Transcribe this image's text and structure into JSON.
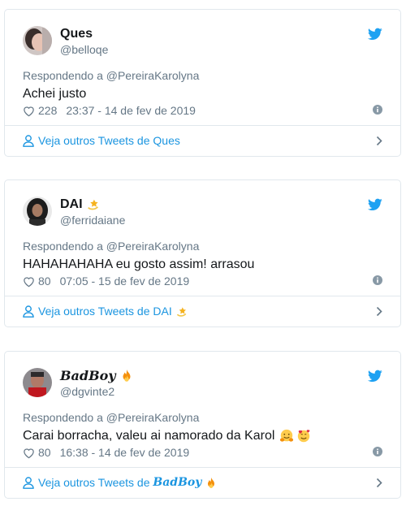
{
  "tweets": [
    {
      "name": "Ques",
      "name_badge": "",
      "handle": "@belloqe",
      "reply_to": "Respondendo a @PereiraKarolyna",
      "text": "Achei justo",
      "text_emojis": [],
      "likes": "228",
      "timestamp": "23:37 - 14 de fev de 2019",
      "footer_prefix": "Veja outros Tweets de ",
      "footer_name": "Ques"
    },
    {
      "name": "DAI",
      "name_badge": "dizzy-star-emoji",
      "handle": "@ferridaiane",
      "reply_to": "Respondendo a @PereiraKarolyna",
      "text": "HAHAHAHAHA eu gosto assim! arrasou",
      "text_emojis": [],
      "likes": "80",
      "timestamp": "07:05 - 15 de fev de 2019",
      "footer_prefix": "Veja outros Tweets de ",
      "footer_name": "DAI"
    },
    {
      "name": "BadBoy",
      "name_badge": "fire-emoji",
      "handle": "@dgvinte2",
      "reply_to": "Respondendo a @PereiraKarolyna",
      "text": "Carai borracha, valeu ai namorado da Karol",
      "text_emojis": [
        "hugging-face-emoji",
        "smiling-face-with-hearts-emoji"
      ],
      "likes": "80",
      "timestamp": "16:38 - 14 de fev de 2019",
      "footer_prefix": "Veja outros Tweets de ",
      "footer_name": "BadBoy"
    }
  ],
  "colors": {
    "twitter_blue": "#1da1f2",
    "link_blue": "#1b95e0",
    "muted_gray": "#657786",
    "border": "#e1e8ed"
  }
}
